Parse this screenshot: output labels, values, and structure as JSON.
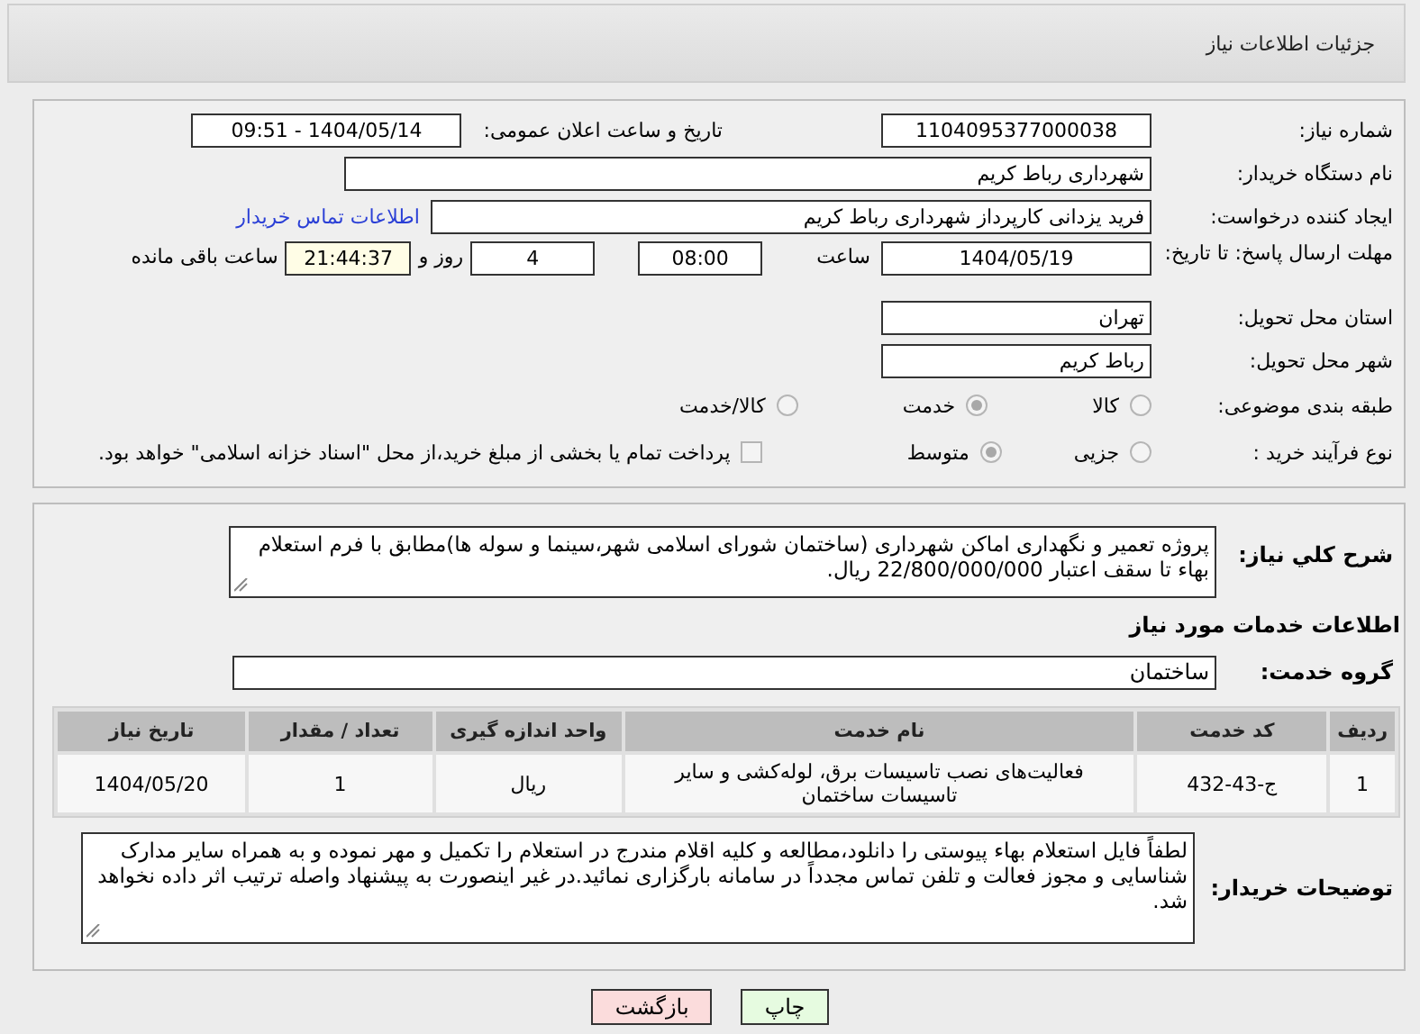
{
  "header": {
    "title": "جزئیات اطلاعات نیاز"
  },
  "details": {
    "need_number": {
      "label": "شماره نیاز:",
      "value": "1104095377000038"
    },
    "announce": {
      "label": "تاریخ و ساعت اعلان عمومی:",
      "value": "1404/05/14 - 09:51"
    },
    "buyer": {
      "label": "نام دستگاه خریدار:",
      "value": "شهرداری رباط کریم"
    },
    "creator": {
      "label": "ایجاد کننده درخواست:",
      "value": "فرید یزدانی کارپرداز شهرداری رباط کریم",
      "link": "اطلاعات تماس خریدار"
    },
    "deadline": {
      "label": "مهلت ارسال پاسخ: تا تاریخ:",
      "date": "1404/05/19",
      "time_label": "ساعت",
      "time": "08:00",
      "days": "4",
      "days_label": "روز و",
      "remaining": "21:44:37",
      "remaining_label": "ساعت باقی مانده"
    },
    "province": {
      "label": "استان محل تحویل:",
      "value": "تهران"
    },
    "city": {
      "label": "شهر محل تحویل:",
      "value": "رباط کریم"
    },
    "category": {
      "label": "طبقه بندی موضوعی:",
      "options": [
        {
          "label": "کالا",
          "selected": false
        },
        {
          "label": "خدمت",
          "selected": true
        },
        {
          "label": "کالا/خدمت",
          "selected": false
        }
      ]
    },
    "process": {
      "label": "نوع فرآیند خرید :",
      "options": [
        {
          "label": "جزیی",
          "selected": false
        },
        {
          "label": "متوسط",
          "selected": true
        }
      ],
      "payment": {
        "checked": false,
        "label": "پرداخت تمام یا بخشی از مبلغ خرید،از محل \"اسناد خزانه اسلامی\" خواهد بود."
      }
    }
  },
  "services": {
    "description": {
      "label": "شرح کلي نياز:",
      "value": "پروژه تعمیر و نگهداری اماکن شهرداری (ساختمان شورای اسلامی شهر،سینما و سوله ها)مطابق با فرم استعلام بهاء تا سقف اعتبار 22/800/000/000 ریال."
    },
    "heading": "اطلاعات خدمات مورد نیاز",
    "group": {
      "label": "گروه خدمت:",
      "value": "ساختمان"
    },
    "table": {
      "columns": [
        "ردیف",
        "کد خدمت",
        "نام خدمت",
        "واحد اندازه گیری",
        "تعداد / مقدار",
        "تاریخ نیاز"
      ],
      "rows": [
        [
          "1",
          "ج-43-432",
          "فعالیت‌های نصب تاسیسات برق، لوله‌کشی و سایر تاسیسات ساختمان",
          "ریال",
          "1",
          "1404/05/20"
        ]
      ]
    },
    "notes": {
      "label": "توضیحات خریدار:",
      "value": "لطفاً فایل استعلام بهاء پیوستی را دانلود،مطالعه و کلیه اقلام مندرج در استعلام را تکمیل و مهر نموده و به همراه سایر مدارک شناسایی و مجوز فعالت و تلفن تماس مجدداً در سامانه بارگزاری نمائید.در غیر اینصورت به پیشنهاد واصله ترتیب اثر داده نخواهد شد."
    }
  },
  "buttons": [
    {
      "kind": "print",
      "label": "چاپ"
    },
    {
      "kind": "back",
      "label": "بازگشت"
    }
  ]
}
